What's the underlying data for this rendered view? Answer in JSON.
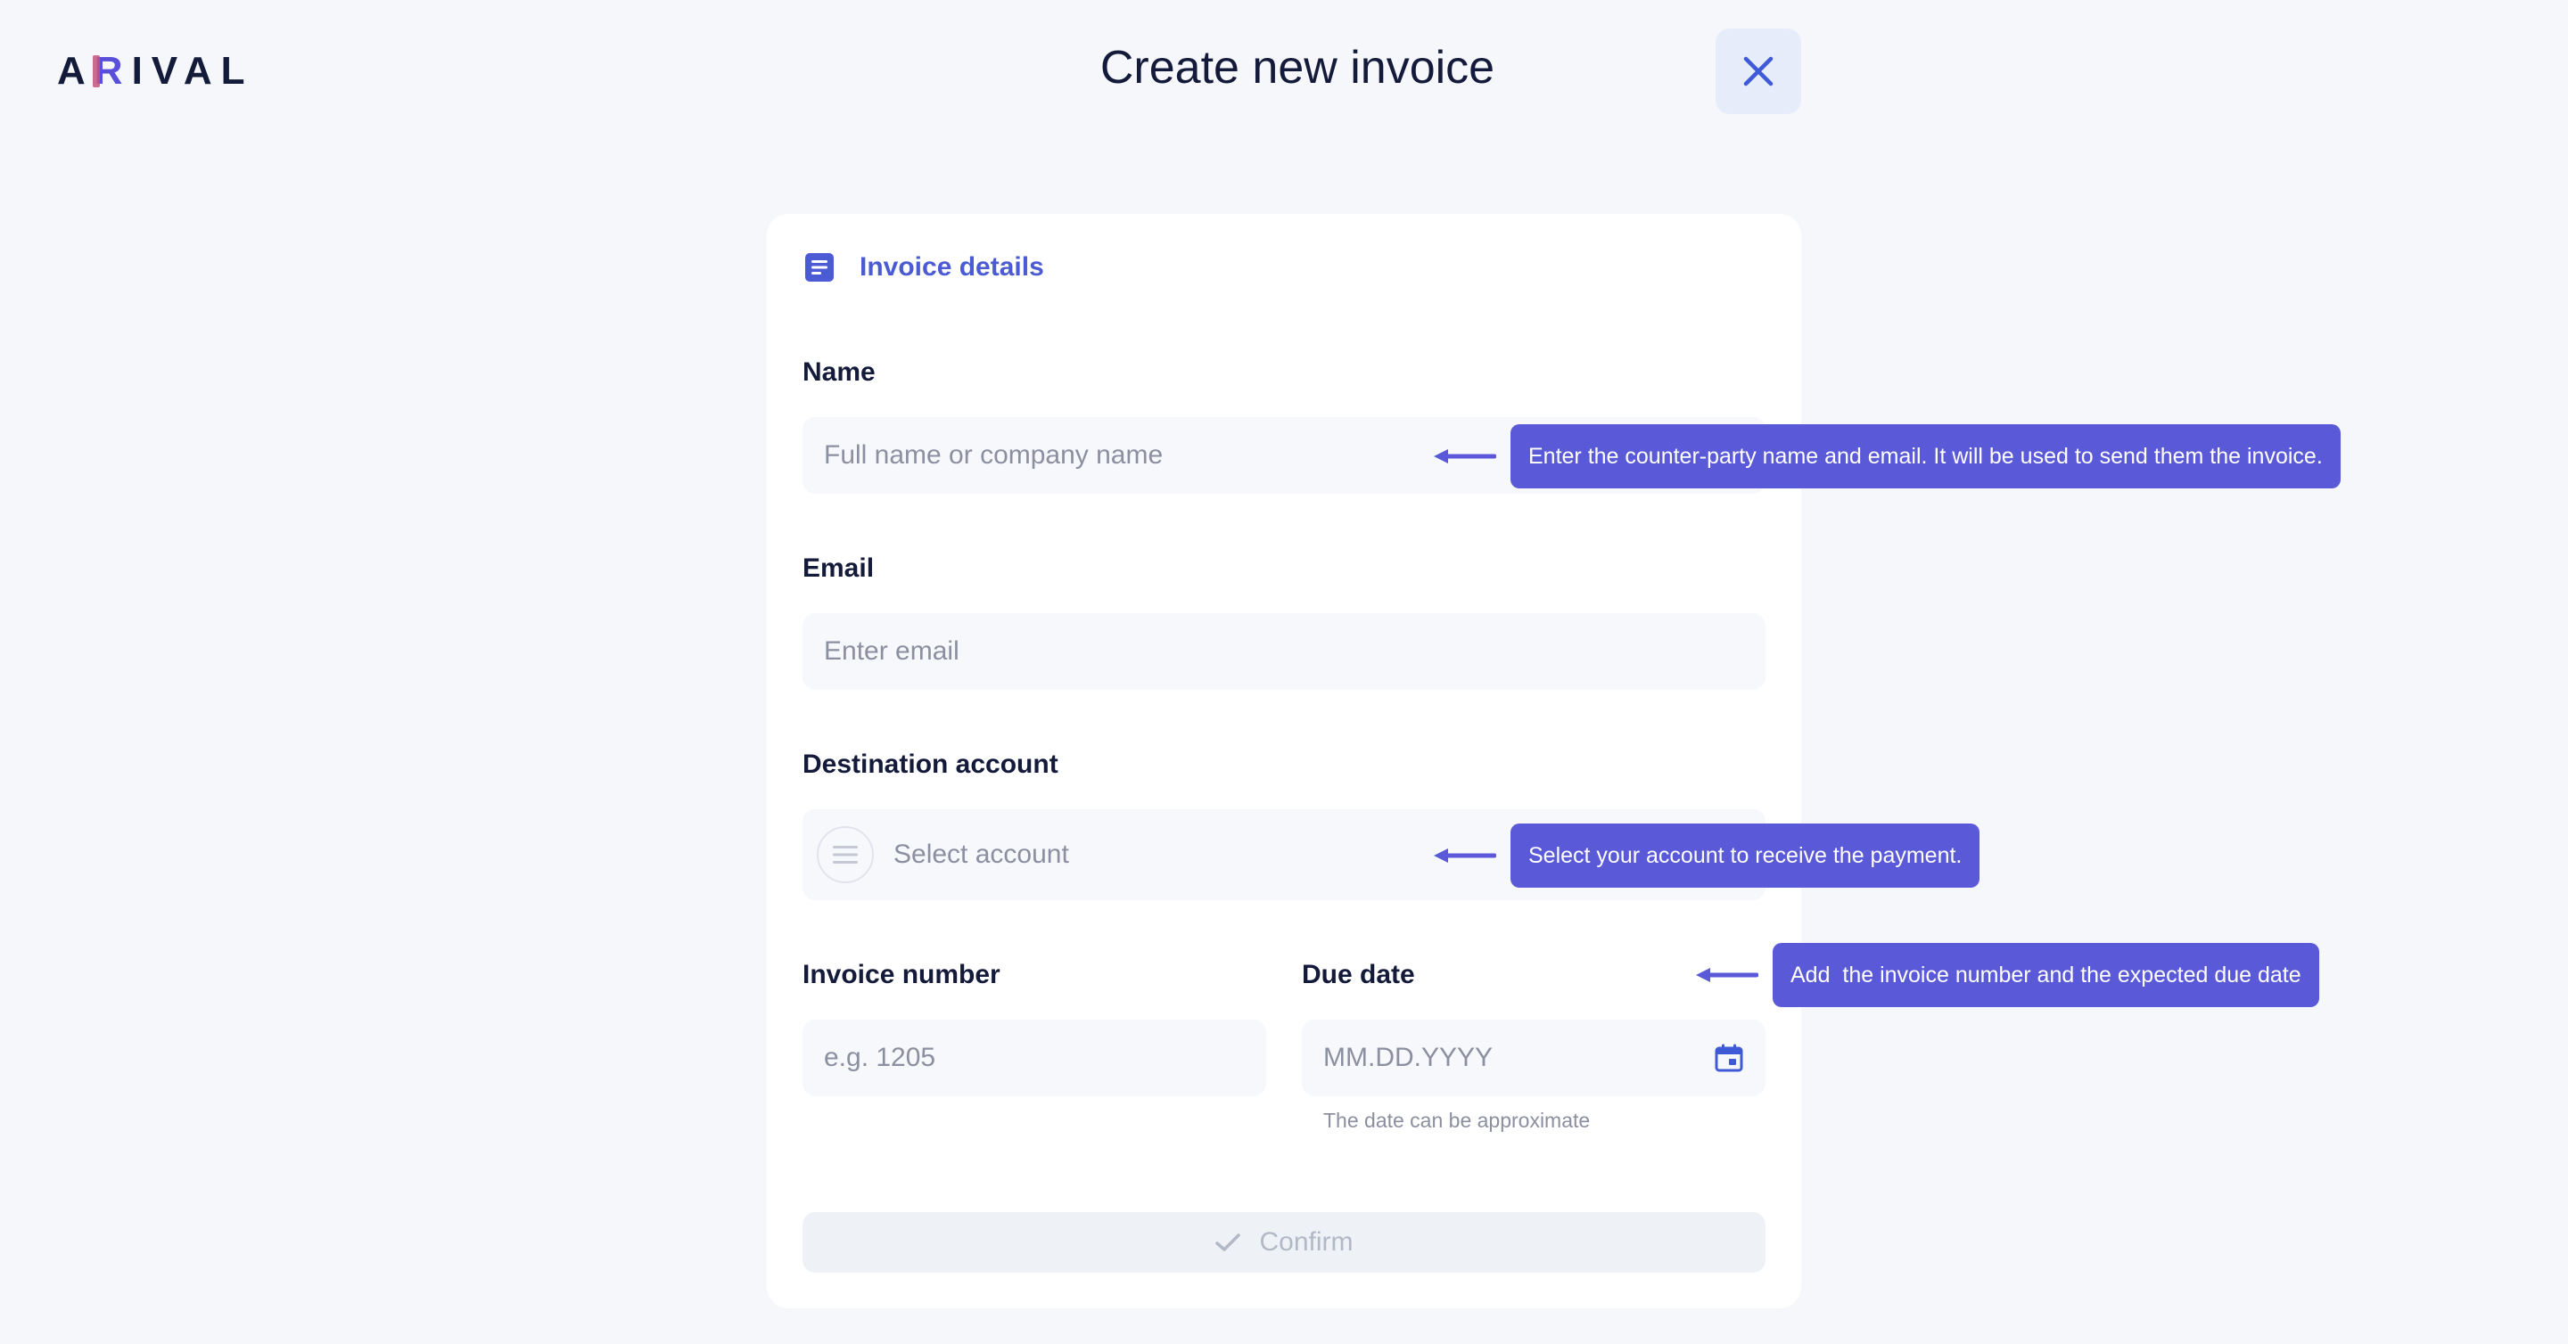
{
  "header": {
    "logo": {
      "pre": "A",
      "accent": "R",
      "post": "IVAL"
    },
    "title": "Create new invoice",
    "close_icon": "close-icon"
  },
  "colors": {
    "accent": "#4a5bd4",
    "tooltip": "#5a59d8",
    "background": "#f5f7fb",
    "card": "#ffffff"
  },
  "form": {
    "section_title": "Invoice details",
    "section_icon": "document-icon",
    "name": {
      "label": "Name",
      "placeholder": "Full name or company name",
      "value": ""
    },
    "email": {
      "label": "Email",
      "placeholder": "Enter email",
      "value": ""
    },
    "destination": {
      "label": "Destination account",
      "placeholder": "Select account",
      "icon": "list-icon"
    },
    "invoice_number": {
      "label": "Invoice number",
      "placeholder": "e.g. 1205",
      "value": ""
    },
    "due_date": {
      "label": "Due date",
      "placeholder": "MM.DD.YYYY",
      "hint": "The date can be approximate",
      "icon": "calendar-icon"
    },
    "confirm": {
      "label": "Confirm",
      "icon": "check-icon"
    }
  },
  "tooltips": {
    "name": "Enter the counter-party name and email. It will be used to send them the invoice.",
    "account": "Select your account to receive the payment.",
    "invoice": "Add  the invoice number and the expected due date"
  }
}
